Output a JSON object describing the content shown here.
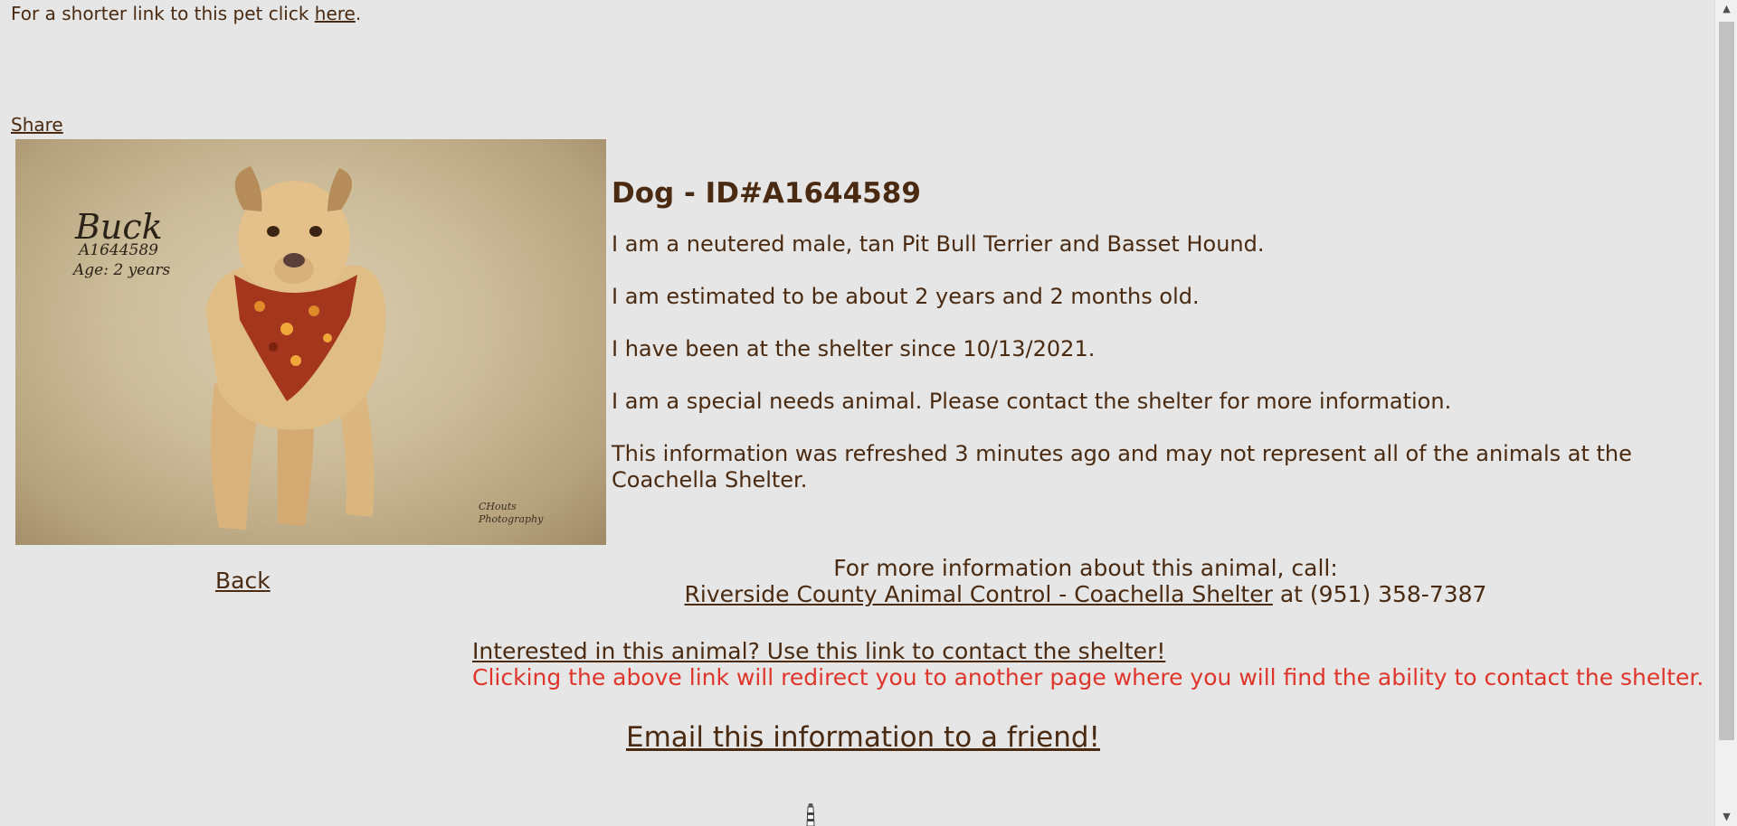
{
  "top": {
    "prefix": "For a shorter link to this pet click ",
    "link": "here",
    "suffix": "."
  },
  "share_label": "Share",
  "photo": {
    "name": "Buck",
    "id": "A1644589",
    "age": "Age: 2 years",
    "credit_line1": "CHouts",
    "credit_line2": "Photography"
  },
  "back_label": "Back",
  "info": {
    "title": "Dog - ID#A1644589",
    "line1": "I am a neutered male, tan Pit Bull Terrier and Basset Hound.",
    "line2": "I am estimated to be about 2 years and 2 months old.",
    "line3": "I have been at the shelter since 10/13/2021.",
    "line4": "I am a special needs animal. Please contact the shelter for more information.",
    "line5": "This information was refreshed 3 minutes ago and may not represent all of the animals at the Coachella Shelter."
  },
  "contact": {
    "intro": "For more information about this animal, call:",
    "shelter_link": "Riverside County Animal Control - Coachella Shelter",
    "phone_text": " at (951) 358-7387"
  },
  "interested": {
    "link": "Interested in this animal? Use this link to contact the shelter!",
    "note": "Clicking the above link will redirect you to another page where you will find the ability to contact the shelter."
  },
  "email_label": "Email this information to a friend!",
  "colors": {
    "background": "#e6e6e6",
    "text": "#4a2a10",
    "warning": "#e0352b"
  },
  "icons": {
    "scroll_up": "chevron-up-icon",
    "scroll_down": "chevron-down-icon",
    "bottom": "lighthouse-icon"
  }
}
